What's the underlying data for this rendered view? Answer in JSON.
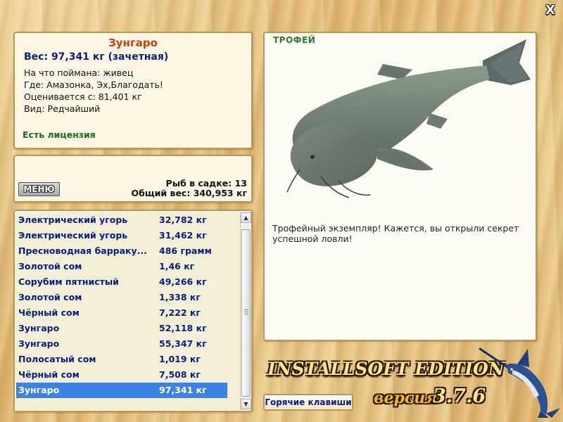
{
  "close_label": "X",
  "catch_info": {
    "title": "Зунгаро",
    "weight": "Вес: 97,341 кг (зачетная)",
    "bait": "На что поймана: живец",
    "where": "Где: Амазонка, Эх,Благодать!",
    "value": "Оценивается с: 81,401 кг",
    "kind": "Вид: Редчайший",
    "license": "Есть лицензия"
  },
  "keepnet": {
    "menu_label": "МЕНЮ",
    "fish_count": "Рыб в садке: 13",
    "total_weight": "Общий вес: 340,953 кг"
  },
  "catch_list": {
    "rows": [
      {
        "name": "Электрический угорь",
        "weight": "32,782 кг"
      },
      {
        "name": "Электрический угорь",
        "weight": "31,462 кг"
      },
      {
        "name": "Пресноводная барраку...",
        "weight": "486 грамм"
      },
      {
        "name": "Золотой сом",
        "weight": "1,46 кг"
      },
      {
        "name": "Сорубим пятнистый",
        "weight": "49,266 кг"
      },
      {
        "name": "Золотой сом",
        "weight": "1,338 кг"
      },
      {
        "name": "Чёрный сом",
        "weight": "7,222 кг"
      },
      {
        "name": "Зунгаро",
        "weight": "52,118 кг"
      },
      {
        "name": "Зунгаро",
        "weight": "55,347 кг"
      },
      {
        "name": "Полосатый сом",
        "weight": "1,019 кг"
      },
      {
        "name": "Чёрный сом",
        "weight": "7,508 кг"
      },
      {
        "name": "Зунгаро",
        "weight": "97,341 кг"
      }
    ],
    "selected_index": 11,
    "scroll_up_icon": "triangle-up-icon",
    "scroll_down_icon": "triangle-down-icon"
  },
  "trophy": {
    "label": "ТРОФЕЙ",
    "description": "Трофейный экземпляр! Кажется, вы открыли секрет успешной ловли!"
  },
  "hotkeys_label": "Горячие клавиши",
  "branding": {
    "title": "INSTALLSOFT EDITION",
    "version_word": "версия",
    "version_number": "3.7.6"
  },
  "colors": {
    "panel_border": "#b9975a",
    "title_orange": "#c2410c",
    "navy_text": "#0a1e7a",
    "license_green": "#1a6b1a",
    "selection_blue": "#3d83e3"
  }
}
